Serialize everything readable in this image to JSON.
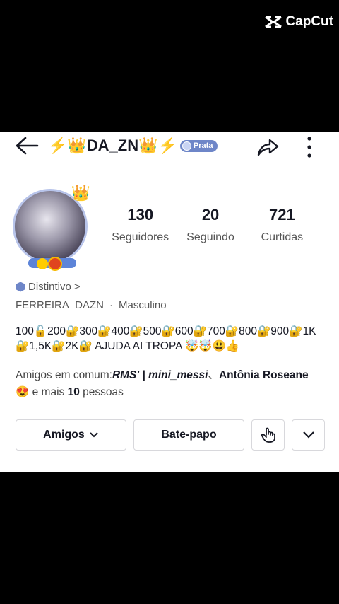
{
  "watermark": {
    "label": "CapCut"
  },
  "header": {
    "title": "⚡👑DA_ZN👑⚡",
    "badge_label": "Prata"
  },
  "stats": [
    {
      "value": "130",
      "label": "Seguidores"
    },
    {
      "value": "20",
      "label": "Seguindo"
    },
    {
      "value": "721",
      "label": "Curtidas"
    }
  ],
  "distintivo": {
    "label": "Distintivo",
    "chevron": ">"
  },
  "profile": {
    "username": "FERREIRA_DAZN",
    "separator": "·",
    "gender": "Masculino"
  },
  "bio": "100🔓200🔐300🔐400🔐500🔐600🔐700🔐800🔐900🔐1K🔐1,5K🔐2K🔐 AJUDA AI TROPA 🤯🤯😃👍",
  "mutual": {
    "prefix": "Amigos em comum:",
    "friend1": "RMS' | mini_messi",
    "sep": "、",
    "friend2": "Antônia Roseane",
    "emoji": "😍",
    "mais": " e mais ",
    "count": "10",
    "suffix": " pessoas"
  },
  "buttons": {
    "friends": "Amigos",
    "chat": "Bate-papo"
  },
  "colors": {
    "badge": "#6e86c8",
    "accent": "#161823"
  }
}
